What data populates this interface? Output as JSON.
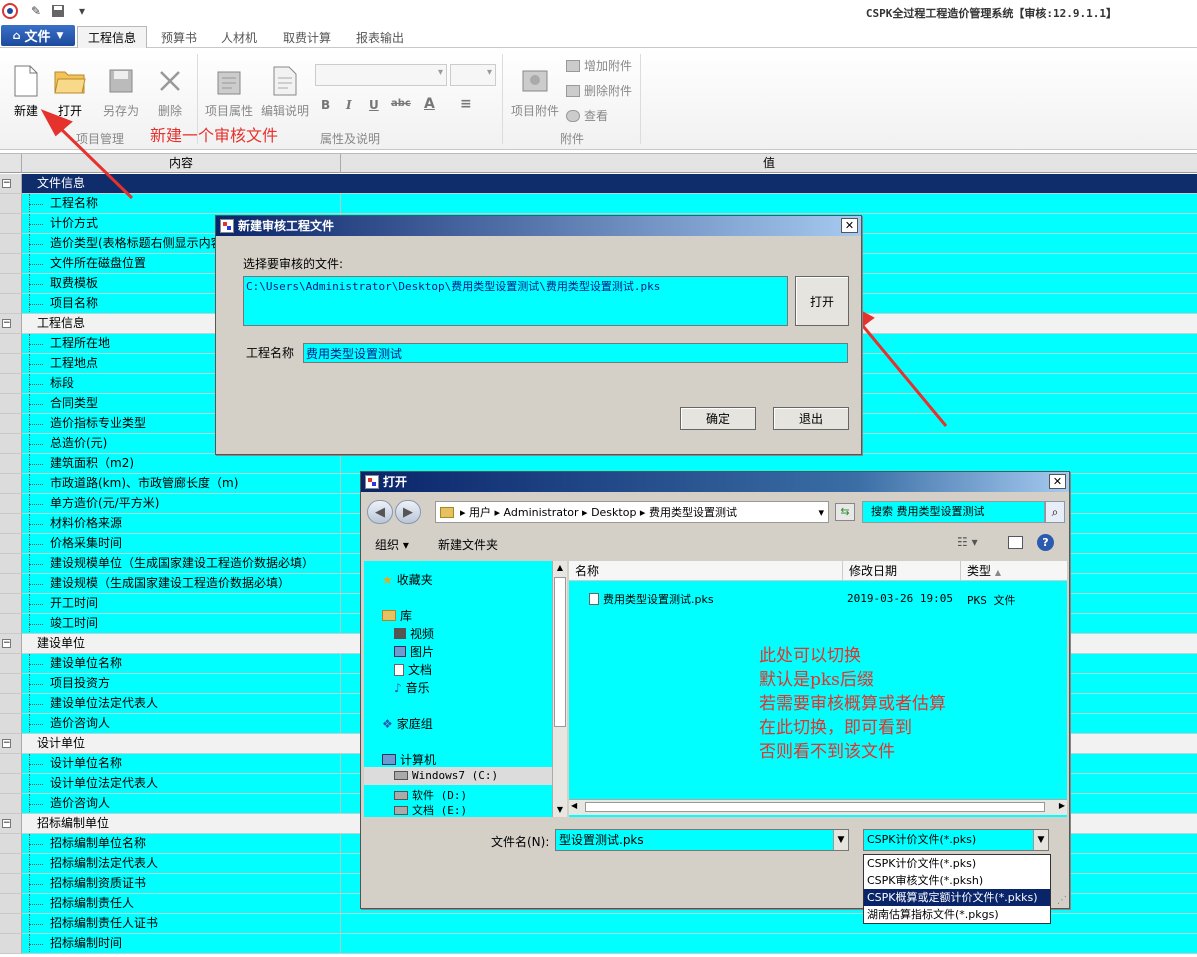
{
  "title_bar": {
    "app_title": "CSPK全过程工程造价管理系统【审核:12.9.1.1】"
  },
  "menu": {
    "file_label": "文件",
    "tabs": [
      "工程信息",
      "预算书",
      "人材机",
      "取费计算",
      "报表输出"
    ]
  },
  "ribbon": {
    "project_mgmt": {
      "new": "新建",
      "open": "打开",
      "save_as": "另存为",
      "delete": "删除",
      "group": "项目管理"
    },
    "props": {
      "project_props": "项目属性",
      "edit_desc": "编辑说明",
      "bold": "B",
      "italic": "I",
      "underline": "U",
      "strike": "abc",
      "font_color": "A",
      "align": "≡",
      "group": "属性及说明"
    },
    "attach": {
      "project_attach": "项目附件",
      "add": "增加附件",
      "remove": "删除附件",
      "view": "查看",
      "group": "附件"
    }
  },
  "annotation_ribbon": "新建一个审核文件",
  "grid": {
    "col_content": "内容",
    "col_value": "值",
    "rows": [
      {
        "type": "cat",
        "label": "文件信息",
        "sel": true
      },
      {
        "type": "item",
        "label": "工程名称"
      },
      {
        "type": "item",
        "label": "计价方式"
      },
      {
        "type": "item",
        "label": "造价类型(表格标题右侧显示内容)"
      },
      {
        "type": "item",
        "label": "文件所在磁盘位置"
      },
      {
        "type": "item",
        "label": "取费模板"
      },
      {
        "type": "item",
        "label": "项目名称"
      },
      {
        "type": "cat",
        "label": "工程信息"
      },
      {
        "type": "item",
        "label": "工程所在地"
      },
      {
        "type": "item",
        "label": "工程地点"
      },
      {
        "type": "item",
        "label": "标段"
      },
      {
        "type": "item",
        "label": "合同类型"
      },
      {
        "type": "item",
        "label": "造价指标专业类型"
      },
      {
        "type": "item",
        "label": "总造价(元)"
      },
      {
        "type": "item",
        "label": "建筑面积（m2)"
      },
      {
        "type": "item",
        "label": "市政道路(km)、市政管廊长度（m)"
      },
      {
        "type": "item",
        "label": "单方造价(元/平方米)"
      },
      {
        "type": "item",
        "label": "材料价格来源"
      },
      {
        "type": "item",
        "label": "价格采集时间"
      },
      {
        "type": "item",
        "label": "建设规模单位（生成国家建设工程造价数据必填）"
      },
      {
        "type": "item",
        "label": "建设规模（生成国家建设工程造价数据必填）"
      },
      {
        "type": "item",
        "label": "开工时间"
      },
      {
        "type": "item",
        "label": "竣工时间"
      },
      {
        "type": "cat",
        "label": "建设单位"
      },
      {
        "type": "item",
        "label": "建设单位名称"
      },
      {
        "type": "item",
        "label": "项目投资方"
      },
      {
        "type": "item",
        "label": "建设单位法定代表人"
      },
      {
        "type": "item",
        "label": "造价咨询人"
      },
      {
        "type": "cat",
        "label": "设计单位"
      },
      {
        "type": "item",
        "label": "设计单位名称"
      },
      {
        "type": "item",
        "label": "设计单位法定代表人"
      },
      {
        "type": "item",
        "label": "造价咨询人"
      },
      {
        "type": "cat",
        "label": "招标编制单位"
      },
      {
        "type": "item",
        "label": "招标编制单位名称"
      },
      {
        "type": "item",
        "label": "招标编制法定代表人"
      },
      {
        "type": "item",
        "label": "招标编制资质证书"
      },
      {
        "type": "item",
        "label": "招标编制责任人"
      },
      {
        "type": "item",
        "label": "招标编制责任人证书"
      },
      {
        "type": "item",
        "label": "招标编制时间"
      }
    ]
  },
  "new_audit_dialog": {
    "title": "新建审核工程文件",
    "select_label": "选择要审核的文件:",
    "file_path": "C:\\Users\\Administrator\\Desktop\\费用类型设置测试\\费用类型设置测试.pks",
    "open_btn": "打开",
    "project_name_label": "工程名称",
    "project_name_value": "费用类型设置测试",
    "ok_btn": "确定",
    "exit_btn": "退出"
  },
  "open_dialog": {
    "title": "打开",
    "breadcrumb": [
      "用户",
      "Administrator",
      "Desktop",
      "费用类型设置测试"
    ],
    "search_placeholder": "搜索 费用类型设置测试",
    "organize": "组织 ▾",
    "new_folder": "新建文件夹",
    "nav": {
      "favorites": "收藏夹",
      "library": "库",
      "videos": "视频",
      "pictures": "图片",
      "documents": "文档",
      "music": "音乐",
      "homegroup": "家庭组",
      "computer": "计算机",
      "drive_c": "Windows7 (C:)",
      "drive_d": "软件 (D:)",
      "drive_e": "文档 (E:)"
    },
    "columns": {
      "name": "名称",
      "date": "修改日期",
      "type": "类型"
    },
    "files": [
      {
        "name": "费用类型设置测试.pks",
        "date": "2019-03-26 19:05",
        "type": "PKS 文件"
      }
    ],
    "filename_label": "文件名(N):",
    "filename_value": "型设置测试.pks",
    "filter_selected": "CSPK计价文件(*.pks)",
    "filter_options": [
      "CSPK计价文件(*.pks)",
      "CSPK审核文件(*.pksh)",
      "CSPK概算或定额计价文件(*.pkks)",
      "湖南估算指标文件(*.pkgs)"
    ],
    "annotation_lines": [
      "此处可以切换",
      "默认是pks后缀",
      "若需要审核概算或者估算",
      "在此切换，即可看到",
      "否则看不到该文件"
    ]
  },
  "colors": {
    "cyan": "#00ffff",
    "selected_row": "#0f2d6b",
    "annotation": "#e5322d",
    "file_menu": "#1c4a9c"
  }
}
